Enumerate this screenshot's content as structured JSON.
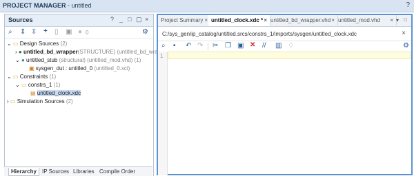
{
  "window": {
    "title_prefix": "PROJECT MANAGER",
    "title_suffix": " - untitled",
    "help_label": "?"
  },
  "sources": {
    "title": "Sources",
    "controls": [
      "?",
      "_",
      "□",
      "▢",
      "×"
    ],
    "toolbar_count": "0",
    "tree": {
      "design_sources": {
        "label": "Design Sources",
        "count": "(2)"
      },
      "bd_wrapper": {
        "name": "untitled_bd_wrapper",
        "detail": "(STRUCTURE) (untitled_bd_wrappe"
      },
      "stub": {
        "name": "untitled_stub",
        "detail": "(structural) (untitled_mod.vhd) (1)"
      },
      "sysgen_dut": {
        "name": "sysgen_dut : untitled_0",
        "detail": "(untitled_0.xci)"
      },
      "constraints": {
        "label": "Constraints",
        "count": "(1)"
      },
      "constrs_1": {
        "label": "constrs_1",
        "count": "(1)"
      },
      "xdc_file": {
        "label": "untitled_clock.xdc"
      },
      "simulation_sources": {
        "label": "Simulation Sources",
        "count": "(2)"
      }
    },
    "bottom_tabs": [
      "Hierarchy",
      "IP Sources",
      "Libraries",
      "Compile Order"
    ]
  },
  "editor": {
    "tabs": [
      {
        "label": "Project Summary"
      },
      {
        "label": "untitled_clock.xdc *"
      },
      {
        "label": "untitled_bd_wrapper.vhd"
      },
      {
        "label": "untitled_mod.vhd"
      }
    ],
    "tab_close": "×",
    "file_path": "C:/sys_gen/ip_catalog/untitled.srcs/constrs_1/imports/sysgen/untitled_clock.xdc",
    "line_numbers": [
      "1"
    ]
  },
  "colors": {
    "accent": "#5b92d6",
    "header_bg": "#d8e4f2",
    "selection": "#c9dbf3",
    "current_line": "#fffde0"
  }
}
